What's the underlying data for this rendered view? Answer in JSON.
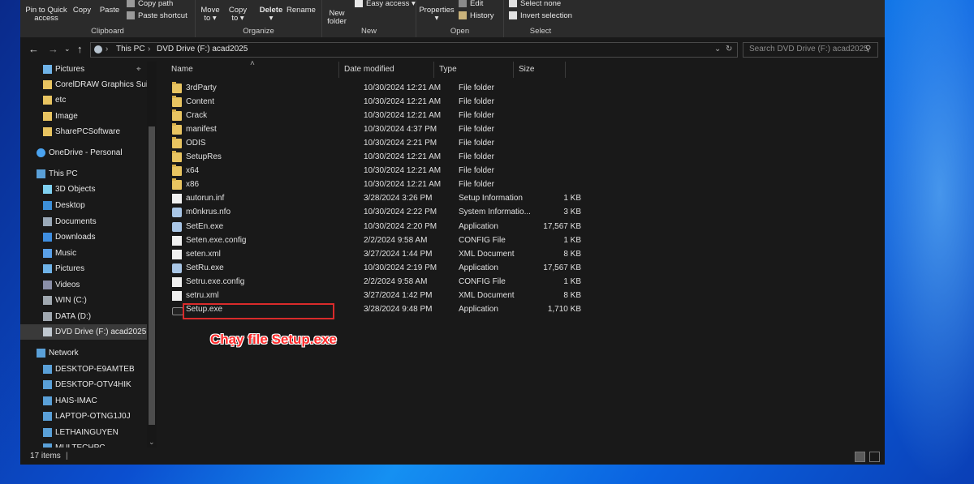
{
  "ribbon": {
    "clipboard": {
      "label": "Clipboard",
      "pin_line1": "Pin to Quick",
      "pin_line2": "access",
      "copy": "Copy",
      "paste": "Paste",
      "copy_path": "Copy path",
      "paste_shortcut": "Paste shortcut"
    },
    "organize": {
      "label": "Organize",
      "move_to_line1": "Move",
      "move_to_line2": "to",
      "copy_to_line1": "Copy",
      "copy_to_line2": "to",
      "delete": "Delete",
      "rename": "Rename"
    },
    "new": {
      "label": "New",
      "new_folder_line1": "New",
      "new_folder_line2": "folder",
      "easy_access": "Easy access"
    },
    "open": {
      "label": "Open",
      "properties": "Properties",
      "edit": "Edit",
      "history": "History"
    },
    "select": {
      "label": "Select",
      "select_none": "Select none",
      "invert_selection": "Invert selection"
    }
  },
  "address": {
    "segments": [
      "This PC",
      "DVD Drive (F:) acad2025"
    ],
    "search_placeholder": "Search DVD Drive (F:) acad2025"
  },
  "nav": {
    "items": [
      {
        "label": "Pictures",
        "icon": "pictures-icon",
        "indent": 1,
        "pinned": true
      },
      {
        "label": "CorelDRAW Graphics Suite",
        "icon": "folder-icon",
        "indent": 1
      },
      {
        "label": "etc",
        "icon": "folder-icon",
        "indent": 1
      },
      {
        "label": "Image",
        "icon": "folder-icon",
        "indent": 1
      },
      {
        "label": "SharePCSoftware",
        "icon": "folder-icon",
        "indent": 1
      },
      {
        "label": "OneDrive - Personal",
        "icon": "cloud-icon",
        "indent": 0
      },
      {
        "label": "This PC",
        "icon": "computer-icon",
        "indent": 0
      },
      {
        "label": "3D Objects",
        "icon": "cube-icon",
        "indent": 1
      },
      {
        "label": "Desktop",
        "icon": "desktop-icon",
        "indent": 1
      },
      {
        "label": "Documents",
        "icon": "documents-icon",
        "indent": 1
      },
      {
        "label": "Downloads",
        "icon": "download-icon",
        "indent": 1
      },
      {
        "label": "Music",
        "icon": "music-icon",
        "indent": 1
      },
      {
        "label": "Pictures",
        "icon": "pictures-icon",
        "indent": 1
      },
      {
        "label": "Videos",
        "icon": "videos-icon",
        "indent": 1
      },
      {
        "label": "WIN (C:)",
        "icon": "drive-icon",
        "indent": 1
      },
      {
        "label": "DATA (D:)",
        "icon": "drive-icon",
        "indent": 1
      },
      {
        "label": "DVD Drive (F:) acad2025",
        "icon": "dvd-icon",
        "indent": 1,
        "selected": true
      },
      {
        "label": "Network",
        "icon": "network-icon",
        "indent": 0
      },
      {
        "label": "DESKTOP-E9AMTEB",
        "icon": "computer-icon",
        "indent": 1
      },
      {
        "label": "DESKTOP-OTV4HIK",
        "icon": "computer-icon",
        "indent": 1
      },
      {
        "label": "HAIS-IMAC",
        "icon": "computer-icon",
        "indent": 1
      },
      {
        "label": "LAPTOP-OTNG1J0J",
        "icon": "computer-icon",
        "indent": 1
      },
      {
        "label": "LETHAINGUYEN",
        "icon": "computer-icon",
        "indent": 1
      },
      {
        "label": "MULTECHPC",
        "icon": "computer-icon",
        "indent": 1
      }
    ]
  },
  "columns": {
    "name": "Name",
    "date": "Date modified",
    "type": "Type",
    "size": "Size"
  },
  "files": [
    {
      "name": "3rdParty",
      "date": "10/30/2024 12:21 AM",
      "type": "File folder",
      "size": "",
      "kind": "folder"
    },
    {
      "name": "Content",
      "date": "10/30/2024 12:21 AM",
      "type": "File folder",
      "size": "",
      "kind": "folder"
    },
    {
      "name": "Crack",
      "date": "10/30/2024 12:21 AM",
      "type": "File folder",
      "size": "",
      "kind": "folder"
    },
    {
      "name": "manifest",
      "date": "10/30/2024 4:37 PM",
      "type": "File folder",
      "size": "",
      "kind": "folder"
    },
    {
      "name": "ODIS",
      "date": "10/30/2024 2:21 PM",
      "type": "File folder",
      "size": "",
      "kind": "folder"
    },
    {
      "name": "SetupRes",
      "date": "10/30/2024 12:21 AM",
      "type": "File folder",
      "size": "",
      "kind": "folder"
    },
    {
      "name": "x64",
      "date": "10/30/2024 12:21 AM",
      "type": "File folder",
      "size": "",
      "kind": "folder"
    },
    {
      "name": "x86",
      "date": "10/30/2024 12:21 AM",
      "type": "File folder",
      "size": "",
      "kind": "folder"
    },
    {
      "name": "autorun.inf",
      "date": "3/28/2024 3:26 PM",
      "type": "Setup Information",
      "size": "1 KB",
      "kind": "doc"
    },
    {
      "name": "m0nkrus.nfo",
      "date": "10/30/2024 2:22 PM",
      "type": "System Informatio...",
      "size": "3 KB",
      "kind": "exe"
    },
    {
      "name": "SetEn.exe",
      "date": "10/30/2024 2:20 PM",
      "type": "Application",
      "size": "17,567 KB",
      "kind": "exe"
    },
    {
      "name": "Seten.exe.config",
      "date": "2/2/2024 9:58 AM",
      "type": "CONFIG File",
      "size": "1 KB",
      "kind": "doc"
    },
    {
      "name": "seten.xml",
      "date": "3/27/2024 1:44 PM",
      "type": "XML Document",
      "size": "8 KB",
      "kind": "doc"
    },
    {
      "name": "SetRu.exe",
      "date": "10/30/2024 2:19 PM",
      "type": "Application",
      "size": "17,567 KB",
      "kind": "exe"
    },
    {
      "name": "Setru.exe.config",
      "date": "2/2/2024 9:58 AM",
      "type": "CONFIG File",
      "size": "1 KB",
      "kind": "doc"
    },
    {
      "name": "setru.xml",
      "date": "3/27/2024 1:42 PM",
      "type": "XML Document",
      "size": "8 KB",
      "kind": "doc"
    },
    {
      "name": "Setup.exe",
      "date": "3/28/2024 9:48 PM",
      "type": "Application",
      "size": "1,710 KB",
      "kind": "setup"
    }
  ],
  "annotation": "Chạy file Setup.exe",
  "status": {
    "items_count": "17 items"
  },
  "colors": {
    "highlight": "#d92b2b",
    "folder": "#e8c461",
    "window_bg": "#191919",
    "ribbon_bg": "#2b2b2b"
  }
}
